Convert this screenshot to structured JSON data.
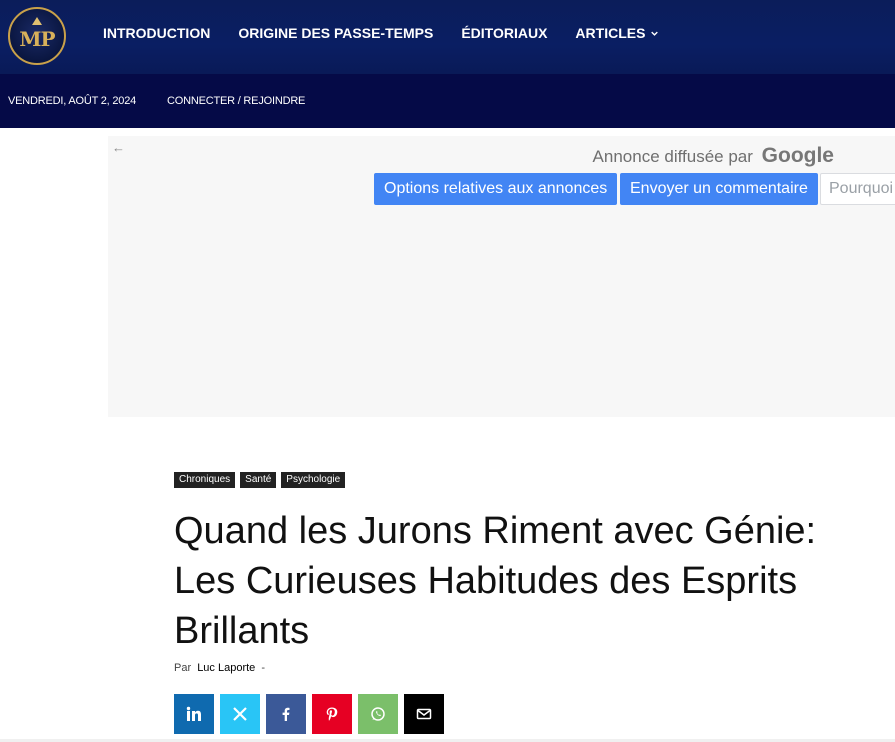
{
  "header": {
    "logo_text": "MP",
    "nav": [
      {
        "label": "INTRODUCTION"
      },
      {
        "label": "ORIGINE DES PASSE-TEMPS"
      },
      {
        "label": "ÉDITORIAUX"
      },
      {
        "label": "ARTICLES"
      }
    ],
    "date": "VENDREDI, AOÛT 2, 2024",
    "login": "CONNECTER / REJOINDRE"
  },
  "ad": {
    "back_icon": "←",
    "served_by": "Annonce diffusée par",
    "google": "Google",
    "buttons": [
      {
        "label": "Options relatives aux annonces"
      },
      {
        "label": "Envoyer un commentaire"
      },
      {
        "label": "Pourquoi"
      }
    ]
  },
  "article": {
    "tags": [
      {
        "label": "Chroniques"
      },
      {
        "label": "Santé"
      },
      {
        "label": "Psychologie"
      }
    ],
    "title": "Quand les Jurons Riment avec Génie: Les Curieuses Habitudes des Esprits Brillants",
    "by_prefix": "Par",
    "author": "Luc Laporte",
    "dash": "-"
  },
  "share": {
    "icons": [
      "linkedin-icon",
      "x-icon",
      "facebook-icon",
      "pinterest-icon",
      "whatsapp-icon",
      "email-icon"
    ]
  },
  "colors": {
    "nav_bg": "#0a1e63",
    "subbar_bg": "#050a47",
    "ad_button": "#4285f4",
    "logo_gold": "#c9a14a"
  }
}
